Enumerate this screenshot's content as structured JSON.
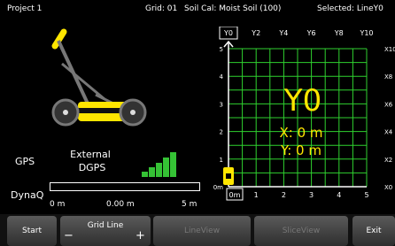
{
  "status": {
    "project": "Project 1",
    "grid": "Grid: 01",
    "soil_cal": "Soil Cal: Moist Soil (100)",
    "selected": "Selected: LineY0"
  },
  "gps": {
    "label": "GPS",
    "source_line1": "External",
    "source_line2": "DGPS",
    "signal_bars_lit": 5,
    "signal_bars_total": 5
  },
  "dynaq": {
    "label": "DynaQ",
    "left_tick": "0 m",
    "value": "0.00 m",
    "right_tick": "5 m",
    "fill_fraction": 0.0
  },
  "grid": {
    "columns_top": [
      "Y0",
      "Y2",
      "Y4",
      "Y6",
      "Y8",
      "Y10"
    ],
    "selected_column": "Y0",
    "rows_right": [
      "X10",
      "X8",
      "X6",
      "X4",
      "X2",
      "X0"
    ],
    "y_axis": [
      "5",
      "4",
      "3",
      "2",
      "1",
      "0m"
    ],
    "x_axis": [
      "0m",
      "1",
      "2",
      "3",
      "4",
      "5"
    ],
    "overlay_title": "Y0",
    "overlay_x": "X: 0 m",
    "overlay_y": "Y: 0 m",
    "grid_color": "#2fd12f",
    "accent_color": "#ffe600"
  },
  "buttons": {
    "start": "Start",
    "grid_line": "Grid Line",
    "minus": "−",
    "plus": "+",
    "line_view": "LineView",
    "slice_view": "SliceView",
    "exit": "Exit"
  }
}
